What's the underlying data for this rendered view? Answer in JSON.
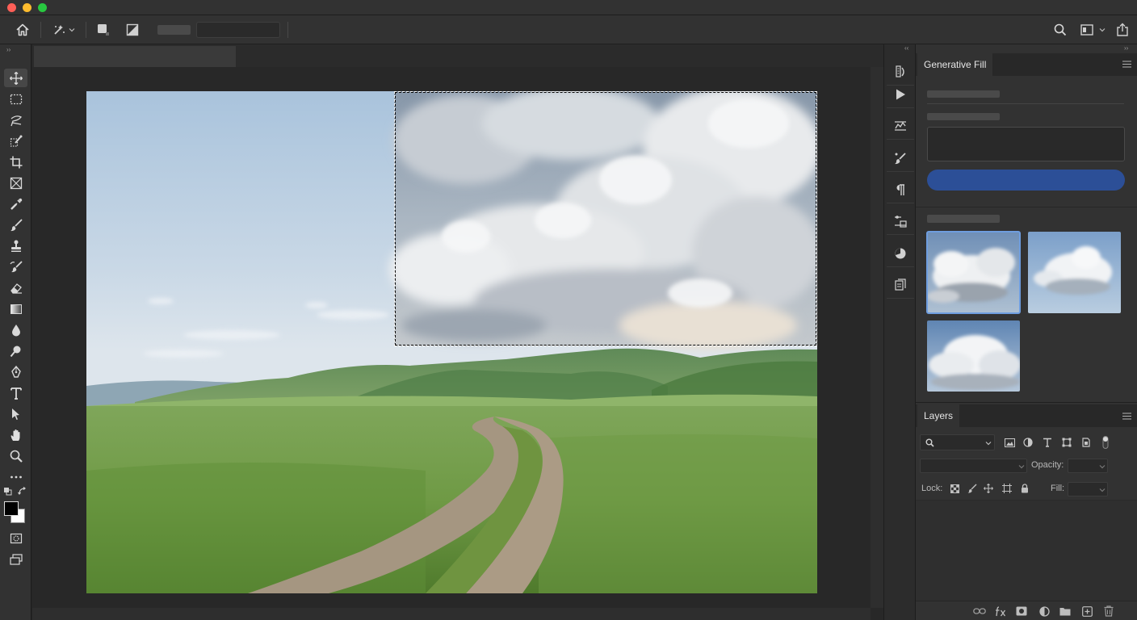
{
  "window": {
    "traffic_colors": [
      "#fe5f57",
      "#febc2e",
      "#28c840"
    ]
  },
  "options_bar": {
    "icons": [
      "home-icon",
      "tool-preset-icon",
      "chevron-down-icon",
      "square-icon",
      "invert-icon",
      "search-icon",
      "workspace-icon",
      "chevron-down-icon",
      "share-icon"
    ]
  },
  "toolbar": {
    "tools": [
      "move-tool",
      "marquee-tool",
      "lasso-tool",
      "object-select-tool",
      "crop-tool",
      "frame-tool",
      "eyedropper-tool",
      "brush-tool",
      "stamp-tool",
      "history-brush-tool",
      "eraser-tool",
      "gradient-tool",
      "blur-tool",
      "dodge-tool",
      "pen-tool",
      "type-tool",
      "path-select-tool",
      "hand-tool",
      "zoom-tool",
      "more-tools"
    ],
    "active_tool": "move-tool",
    "foreground_color": "#000000",
    "background_color": "#ffffff"
  },
  "generative_fill": {
    "tab_label": "Generative Fill",
    "accent_color": "#2c4f97",
    "variations_count": 3,
    "selected_variation": 0
  },
  "layers": {
    "tab_label": "Layers",
    "opacity_label": "Opacity:",
    "lock_label": "Lock:",
    "fill_label": "Fill:"
  }
}
